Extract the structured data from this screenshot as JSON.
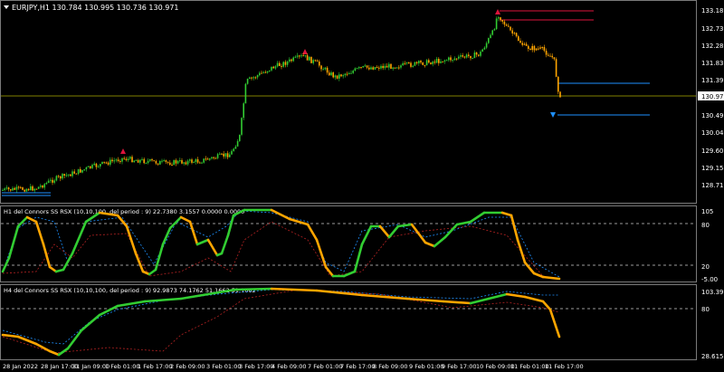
{
  "main": {
    "header": "EURJPY,H1  130.784 130.995 130.736 130.971",
    "price_labels": [
      "133.180",
      "132.730",
      "132.280",
      "131.830",
      "131.390",
      "130.971",
      "130.490",
      "130.040",
      "129.600",
      "129.150",
      "128.710"
    ],
    "current_price": "130.971"
  },
  "indicator1": {
    "header": "H1 del Connors SS RSX (10,10,100, del period : 9) 22.7380 3.1557 0.0000 0.0000",
    "levels": [
      "105",
      "80",
      "20",
      "-5.00"
    ]
  },
  "indicator2": {
    "header": "H4 del Connors SS RSX (10,10,100, del period : 9) 92.9873 74.1762 51.1662 51.1662",
    "levels": [
      "103.3992",
      "80",
      "28.6159"
    ]
  },
  "time_axis": [
    "28 Jan 2022",
    "28 Jan 17:00",
    "31 Jan 09:00",
    "1 Feb 01:00",
    "1 Feb 17:00",
    "2 Feb 09:00",
    "3 Feb 01:00",
    "3 Feb 17:00",
    "4 Feb 09:00",
    "7 Feb 01:00",
    "7 Feb 17:00",
    "8 Feb 09:00",
    "9 Feb 01:00",
    "9 Feb 17:00",
    "10 Feb 09:00",
    "11 Feb 01:00",
    "11 Feb 17:00"
  ],
  "colors": {
    "bull": "#32cd32",
    "bear": "#ffa500",
    "grid": "#7a7a7a",
    "hline": "#808000",
    "blue": "#1e90ff",
    "red": "#dc143c"
  }
}
